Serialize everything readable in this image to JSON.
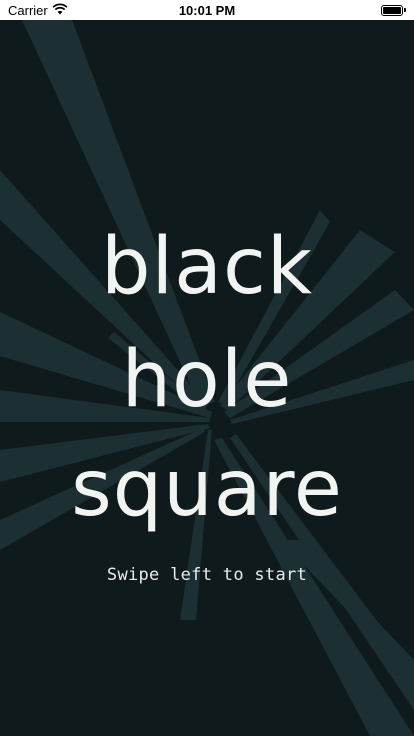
{
  "status_bar": {
    "carrier": "Carrier",
    "time": "10:01 PM",
    "wifi_icon": "wifi-icon",
    "battery_icon": "battery-icon"
  },
  "title": {
    "line1": "black",
    "line2": "hole",
    "line3": "square"
  },
  "instruction": "Swipe left to start",
  "colors": {
    "background": "#0f1a1c",
    "rays": "#1c2f33",
    "text": "#f2f4f2"
  }
}
